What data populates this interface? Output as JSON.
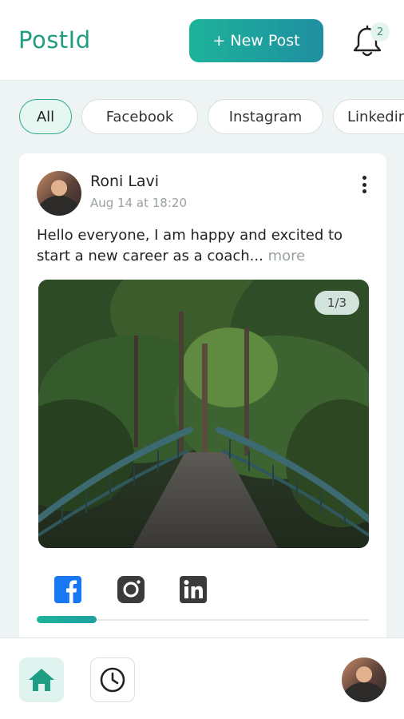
{
  "header": {
    "logo": "PostId",
    "new_post_label": "+ New Post",
    "notification_count": "2"
  },
  "filters": [
    {
      "label": "All",
      "active": true
    },
    {
      "label": "Facebook",
      "active": false
    },
    {
      "label": "Instagram",
      "active": false
    },
    {
      "label": "Linkedin",
      "active": false
    }
  ],
  "post": {
    "author": "Roni Lavi",
    "date": "Aug 14 at 18:20",
    "text": "Hello everyone, I am happy and excited to start a new career as a coach...",
    "more_label": "more",
    "image_counter": "1/3",
    "networks": [
      "facebook-icon",
      "instagram-icon",
      "linkedin-icon"
    ],
    "progress_fraction": 0.18
  },
  "bottom_nav": {
    "items": [
      "home-icon",
      "clock-icon",
      "profile-avatar"
    ]
  },
  "colors": {
    "brand": "#1f9f7f",
    "accent_gradient_start": "#1db39a",
    "accent_gradient_end": "#1f8fa1",
    "facebook": "#1877f2",
    "page_background": "#eef3f4"
  }
}
